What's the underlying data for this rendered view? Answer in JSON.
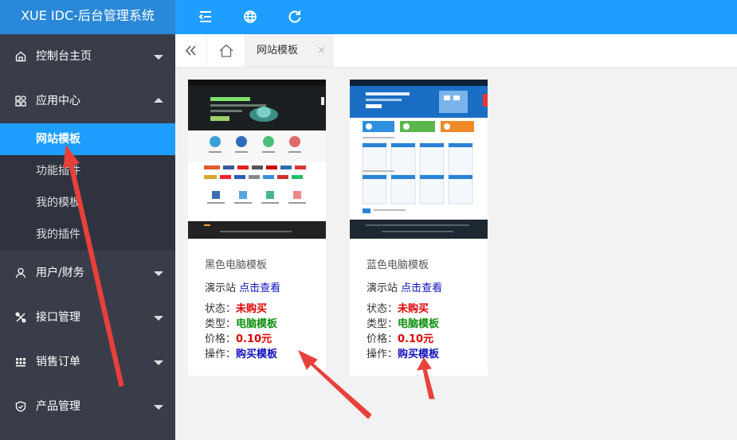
{
  "header": {
    "brand": "XUE IDC-后台管理系统",
    "icons": [
      "menu-collapse-icon",
      "globe-icon",
      "refresh-icon"
    ]
  },
  "sidebar": {
    "items": [
      {
        "label": "控制台主页",
        "icon": "monitor-icon",
        "expanded": false
      },
      {
        "label": "应用中心",
        "icon": "apps-icon",
        "expanded": true,
        "children": [
          {
            "label": "网站模板",
            "active": true
          },
          {
            "label": "功能插件",
            "active": false
          },
          {
            "label": "我的模板",
            "active": false
          },
          {
            "label": "我的插件",
            "active": false
          }
        ]
      },
      {
        "label": "用户/财务",
        "icon": "user-icon",
        "expanded": false
      },
      {
        "label": "接口管理",
        "icon": "tools-icon",
        "expanded": false
      },
      {
        "label": "销售订单",
        "icon": "grid-icon",
        "expanded": false
      },
      {
        "label": "产品管理",
        "icon": "shield-icon",
        "expanded": false
      }
    ]
  },
  "tabs": {
    "active_tab": "网站模板",
    "close": "×"
  },
  "cards": [
    {
      "title": "黑色电脑模板",
      "demo_label": "演示站",
      "demo_link": "点击查看",
      "status_label": "状态：",
      "status_value": "未购买",
      "type_label": "类型：",
      "type_value": "电脑模板",
      "price_label": "价格：",
      "price_value": "0.10元",
      "action_label": "操作：",
      "action_value": "购买模板",
      "theme": "dark"
    },
    {
      "title": "蓝色电脑模板",
      "demo_label": "演示站",
      "demo_link": "点击查看",
      "status_label": "状态：",
      "status_value": "未购买",
      "type_label": "类型：",
      "type_value": "电脑模板",
      "price_label": "价格：",
      "price_value": "0.10元",
      "action_label": "操作：",
      "action_value": "购买模板",
      "theme": "blue"
    }
  ],
  "colors": {
    "topbar": "#1e9fff",
    "sidebar": "#393d49",
    "active_item": "#1e9fff",
    "annotation_arrow": "#e8413a"
  }
}
